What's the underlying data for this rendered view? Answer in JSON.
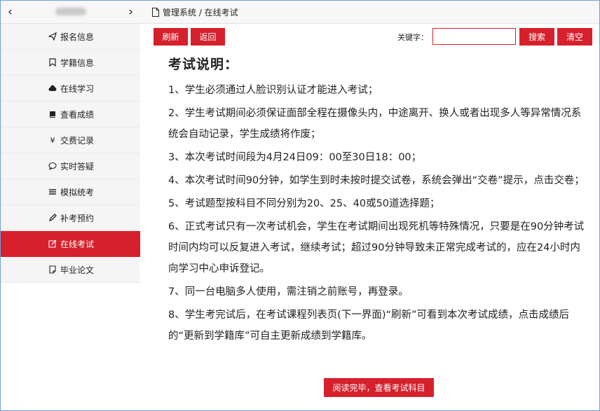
{
  "sidebar": {
    "items": [
      {
        "label": "报名信息",
        "icon": "paper-plane-icon"
      },
      {
        "label": "学籍信息",
        "icon": "bookmark-icon"
      },
      {
        "label": "在线学习",
        "icon": "cloud-icon"
      },
      {
        "label": "查看成绩",
        "icon": "book-icon"
      },
      {
        "label": "交费记录",
        "icon": "yen-icon"
      },
      {
        "label": "实时答疑",
        "icon": "chat-bubble-icon"
      },
      {
        "label": "模拟统考",
        "icon": "list-icon"
      },
      {
        "label": "补考预约",
        "icon": "pencil-icon"
      },
      {
        "label": "在线考试",
        "icon": "edit-icon",
        "active": true
      },
      {
        "label": "毕业论文",
        "icon": "note-icon"
      }
    ]
  },
  "breadcrumb": "管理系统 / 在线考试",
  "toolbar": {
    "refresh": "刷新",
    "back": "返回",
    "keyword_label": "关键字：",
    "keyword_value": "",
    "search": "搜索",
    "clear": "清空"
  },
  "content": {
    "title": "考试说明：",
    "lines": [
      "1、学生必须通过人脸识别认证才能进入考试；",
      "2、学生考试期间必须保证面部全程在摄像头内，中途离开、换人或者出现多人等异常情况系统会自动记录，学生成绩将作废；",
      "3、本次考试时间段为4月24日09：00至30日18：00；",
      "4、本次考试时间90分钟，如学生到时未按时提交试卷，系统会弹出“交卷”提示，点击交卷；",
      "5、考试题型按科目不同分别为20、25、40或50道选择题；",
      "6、正式考试只有一次考试机会，学生在考试期间出现死机等特殊情况，只要是在90分钟考试时间内均可以反复进入考试，继续考试；超过90分钟导致未正常完成考试的，应在24小时内向学习中心申诉登记。",
      "7、同一台电脑多人使用，需注销之前账号，再登录。",
      "8、学生考完试后，在考试课程列表页(下一界面)“刷新”可看到本次考试成绩，点击成绩后的“更新到学籍库”可自主更新成绩到学籍库。"
    ]
  },
  "read_button": "阅读完毕，查看考试科目",
  "colors": {
    "accent": "#d6202c",
    "frame": "#6f9fd8"
  }
}
